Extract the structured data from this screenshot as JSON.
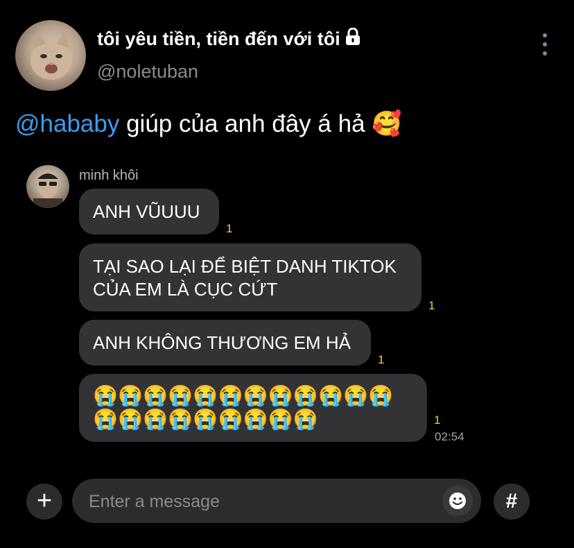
{
  "header": {
    "display_name": "tôi yêu tiền, tiền đến với tôi",
    "username": "@noletuban",
    "lock_icon": "lock-icon",
    "more_icon": "more-vertical-icon"
  },
  "post": {
    "mention": "@hababy",
    "text": " giúp của anh đây á hả ",
    "emoji": "🥰"
  },
  "chat": {
    "sender": "minh khôi",
    "messages": [
      {
        "text": "ANH VŨUUU",
        "read": "1"
      },
      {
        "line1": "TẠI SAO LẠI ĐỂ BIỆT DANH TIKTOK",
        "line2": "CỦA EM LÀ CỤC CỨT",
        "read": "1"
      },
      {
        "text": "ANH KHÔNG THƯƠNG EM HẢ",
        "read": "1"
      },
      {
        "row1": "😭😭😭😭😭😭😭😭😭😭😭😭",
        "row2": "😭😭😭😭😭😭😭😭😭",
        "read": "1"
      }
    ],
    "time": "02:54"
  },
  "composer": {
    "placeholder": "Enter a message",
    "plus_label": "+",
    "hash_label": "#"
  },
  "colors": {
    "accent": "#3b9df0",
    "bubble": "#333336",
    "read_marker": "#f2c94c"
  }
}
